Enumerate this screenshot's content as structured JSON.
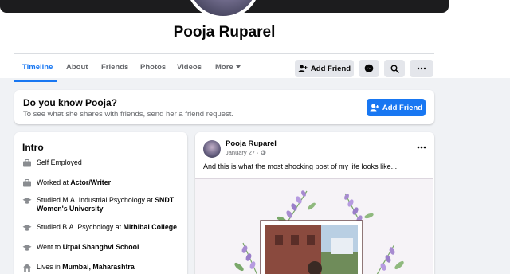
{
  "profile": {
    "name": "Pooja Ruparel"
  },
  "tabs": [
    {
      "label": "Timeline"
    },
    {
      "label": "About"
    },
    {
      "label": "Friends"
    },
    {
      "label": "Photos"
    },
    {
      "label": "Videos"
    },
    {
      "label": "More"
    }
  ],
  "actions": {
    "add_friend_label": "Add Friend"
  },
  "suggestion": {
    "title": "Do you know Pooja?",
    "subtitle": "To see what she shares with friends, send her a friend request.",
    "button_label": "Add Friend"
  },
  "intro": {
    "title": "Intro",
    "items": [
      {
        "text": "Self Employed",
        "icon": "briefcase-icon"
      },
      {
        "prefix": "Worked at ",
        "bold": "Actor/Writer",
        "icon": "briefcase-icon"
      },
      {
        "prefix": "Studied M.A. Industrial Psychology at ",
        "bold": "SNDT Women's University",
        "icon": "graduation-cap-icon"
      },
      {
        "prefix": "Studied B.A. Psychology at ",
        "bold": "Mithibai College",
        "icon": "graduation-cap-icon"
      },
      {
        "prefix": "Went to ",
        "bold": "Utpal Shanghvi School",
        "icon": "graduation-cap-icon"
      },
      {
        "prefix": "Lives in ",
        "bold": "Mumbai, Maharashtra",
        "icon": "home-icon"
      }
    ]
  },
  "post": {
    "author": "Pooja Ruparel",
    "date": "January 27 · ",
    "text": "And this is what the most shocking post of my life looks like..."
  },
  "colors": {
    "accent": "#1877f2",
    "background": "#f0f2f5"
  }
}
